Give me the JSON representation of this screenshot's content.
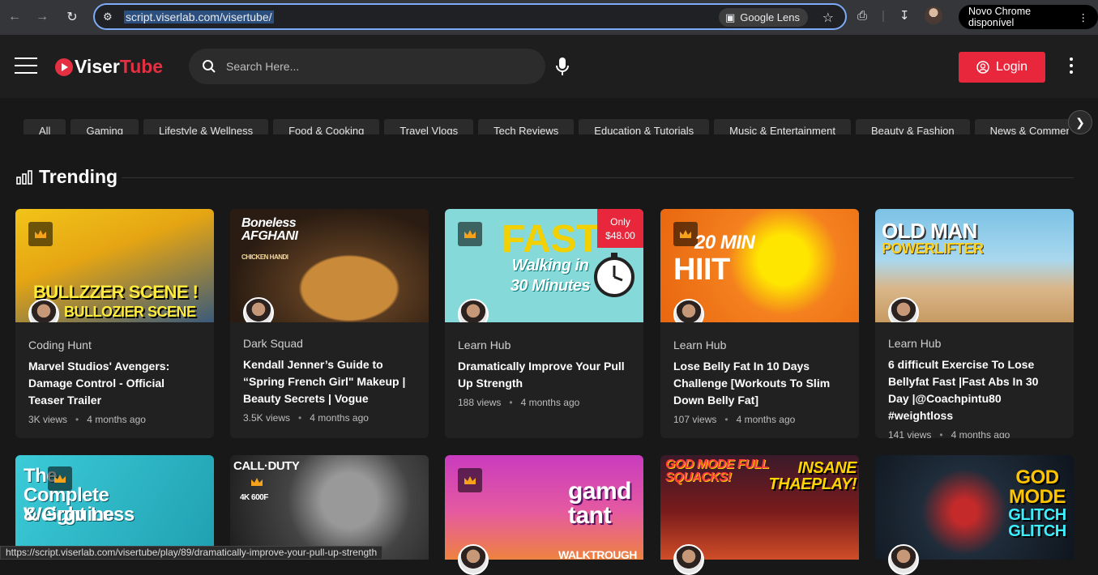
{
  "browser": {
    "url": "script.viserlab.com/visertube/",
    "lens_label": "Google Lens",
    "update_label": "Novo Chrome disponível"
  },
  "header": {
    "logo_a": "Viser",
    "logo_b": "Tube",
    "search_placeholder": "Search Here...",
    "login_label": "Login"
  },
  "categories": [
    "All",
    "Gaming",
    "Lifestyle & Wellness",
    "Food & Cooking",
    "Travel Vlogs",
    "Tech Reviews",
    "Education & Tutorials",
    "Music & Entertainment",
    "Beauty & Fashion",
    "News & Commentary",
    ""
  ],
  "section": {
    "title": "Trending"
  },
  "videos": [
    {
      "channel": "Coding Hunt",
      "title": "Marvel Studios' Avengers: Damage Control - Official Teaser Trailer",
      "views": "3K views",
      "age": "4 months ago",
      "thumb_text": "BULLZZER SCENE !",
      "thumb_text2": "BULLOZIER SCENE",
      "colors": [
        "#f2c418",
        "#3a5a7a"
      ]
    },
    {
      "channel": "Dark Squad",
      "title": "Kendall Jenner’s Guide to “Spring French Girl\" Makeup | Beauty Secrets | Vogue",
      "views": "3.5K views",
      "age": "4 months ago",
      "thumb_text": "Boneless AFGHANI",
      "thumb_text2": "CHICKEN HANDI",
      "colors": [
        "#3a2a1c",
        "#c98a3a"
      ]
    },
    {
      "channel": "Learn Hub",
      "title": "Dramatically Improve Your Pull Up Strength",
      "views": "188 views",
      "age": "4 months ago",
      "thumb_text": "FAST",
      "thumb_text2": "Walking in 30 Minutes",
      "price": "Only $48.00",
      "colors": [
        "#7fd6d6",
        "#f3d100"
      ]
    },
    {
      "channel": "Learn Hub",
      "title": "Lose Belly Fat In 10 Days Challenge [Workouts To Slim Down Belly Fat]",
      "views": "107 views",
      "age": "4 months ago",
      "thumb_text": "20 MIN",
      "thumb_text2": "HIIT",
      "colors": [
        "#f4801e",
        "#ffd400"
      ]
    },
    {
      "channel": "Learn Hub",
      "title": "6 difficult Exercise To Lose Bellyfat Fast |Fast Abs In 30 Day |@Coachpintu80 #weightloss",
      "views": "141 views",
      "age": "4 months ago",
      "thumb_text": "OLD MAN",
      "thumb_text2": "POWERLIFTER",
      "colors": [
        "#6fb6d8",
        "#c79a62"
      ]
    },
    {
      "thumb_text": "The Complete Weight Loss",
      "thumb_text2": "& Grguine",
      "colors": [
        "#27c0cf",
        "#1f9fb0"
      ]
    },
    {
      "thumb_text": "CALL·DUTY",
      "thumb_text2": "4K 600F",
      "colors": [
        "#2e2e2e",
        "#888888"
      ]
    },
    {
      "thumb_text": "gamd tant",
      "thumb_text2": "WALKTROUGH",
      "colors": [
        "#c93bbf",
        "#f08a2e"
      ]
    },
    {
      "thumb_text": "GOD MODE FULL SQUACKS!",
      "thumb_text2": "INSANE THAEPLAY!",
      "colors": [
        "#7a1b1b",
        "#e0572a"
      ]
    },
    {
      "thumb_text": "GOD MODE",
      "thumb_text2": "GLITCH GLITCH",
      "colors": [
        "#1b2a3a",
        "#c52a2a"
      ]
    }
  ],
  "status_url": "https://script.viserlab.com/visertube/play/89/dramatically-improve-your-pull-up-strength"
}
